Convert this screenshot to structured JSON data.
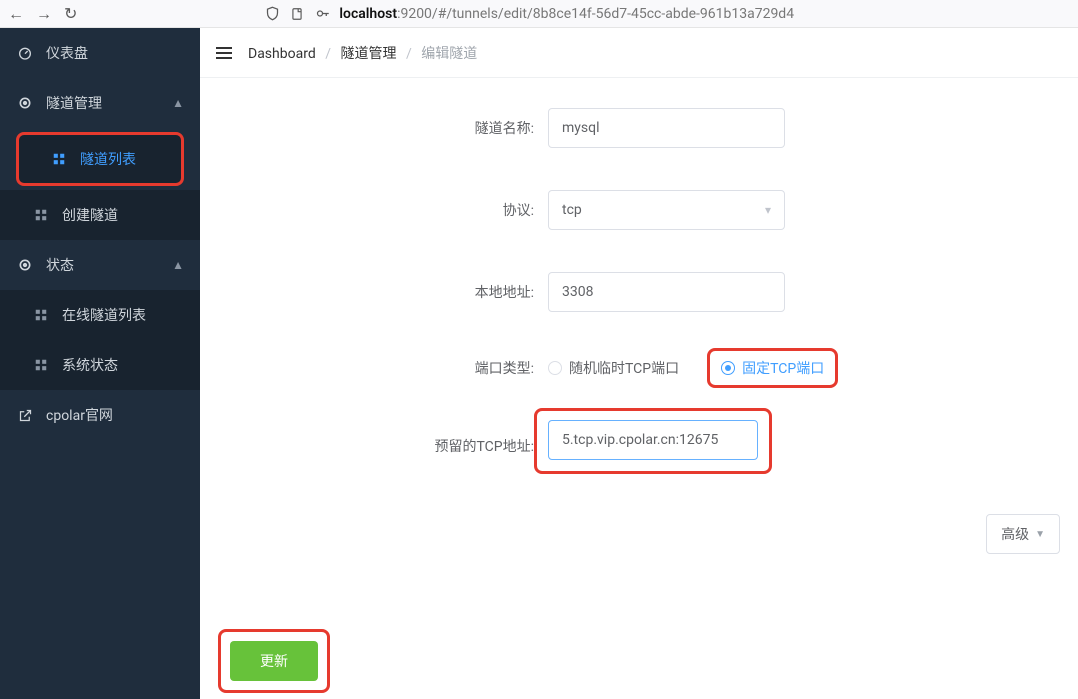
{
  "browser": {
    "host": "localhost",
    "path": ":9200/#/tunnels/edit/8b8ce14f-56d7-45cc-abde-961b13a729d4"
  },
  "sidebar": {
    "dashboard": "仪表盘",
    "tunnelMgmt": "隧道管理",
    "tunnelList": "隧道列表",
    "createTunnel": "创建隧道",
    "status": "状态",
    "onlineList": "在线隧道列表",
    "sysStatus": "系统状态",
    "officialSite": "cpolar官网"
  },
  "breadcrumb": {
    "a": "Dashboard",
    "b": "隧道管理",
    "c": "编辑隧道"
  },
  "form": {
    "labels": {
      "name": "隧道名称:",
      "protocol": "协议:",
      "localAddr": "本地地址:",
      "portType": "端口类型:",
      "reservedTcp": "预留的TCP地址:"
    },
    "values": {
      "name": "mysql",
      "protocol": "tcp",
      "localAddr": "3308",
      "reservedTcp": "5.tcp.vip.cpolar.cn:12675"
    },
    "radios": {
      "random": "随机临时TCP端口",
      "fixed": "固定TCP端口"
    }
  },
  "buttons": {
    "advanced": "高级",
    "submit": "更新"
  }
}
